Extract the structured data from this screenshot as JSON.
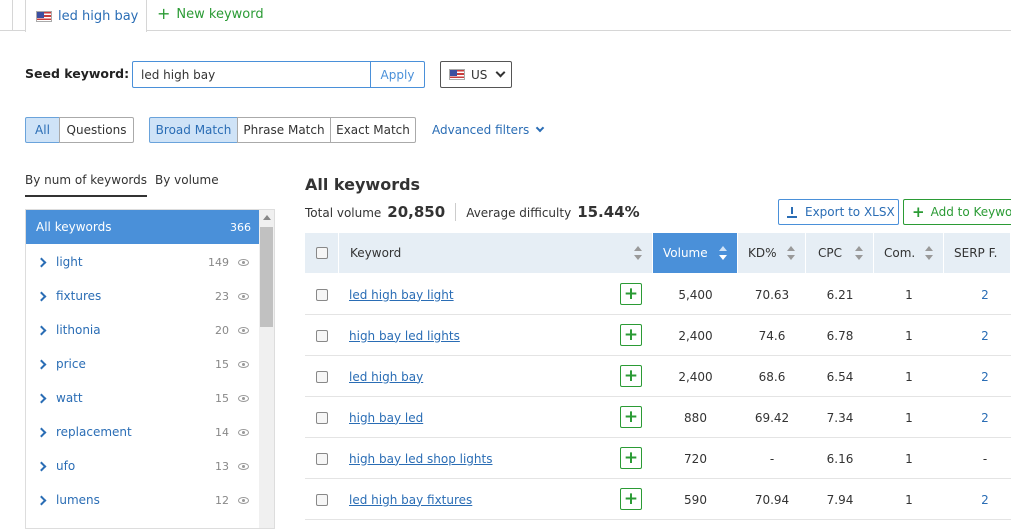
{
  "tabs": {
    "active_label": "led high bay",
    "new_label": "New keyword"
  },
  "seed": {
    "label": "Seed keyword:",
    "value": "led high bay",
    "apply_label": "Apply",
    "database": "US"
  },
  "filters": {
    "all_label": "All",
    "questions_label": "Questions",
    "broad_label": "Broad Match",
    "phrase_label": "Phrase Match",
    "exact_label": "Exact Match",
    "advanced_label": "Advanced filters"
  },
  "sidebar": {
    "tab_by_num": "By num of keywords",
    "tab_by_volume": "By volume",
    "header": {
      "label": "All keywords",
      "count": "366"
    },
    "groups": [
      {
        "label": "light",
        "count": "149"
      },
      {
        "label": "fixtures",
        "count": "23"
      },
      {
        "label": "lithonia",
        "count": "20"
      },
      {
        "label": "price",
        "count": "15"
      },
      {
        "label": "watt",
        "count": "15"
      },
      {
        "label": "replacement",
        "count": "14"
      },
      {
        "label": "ufo",
        "count": "13"
      },
      {
        "label": "lumens",
        "count": "12"
      }
    ]
  },
  "main": {
    "title": "All keywords",
    "total_volume_label": "Total volume",
    "total_volume": "20,850",
    "avg_difficulty_label": "Average difficulty",
    "avg_difficulty": "15.44%",
    "export_label": "Export to XLSX",
    "add_label": "Add to Keyword"
  },
  "table": {
    "headers": {
      "keyword": "Keyword",
      "volume": "Volume",
      "kd": "KD%",
      "cpc": "CPC",
      "com": "Com.",
      "serp": "SERP F."
    },
    "rows": [
      {
        "keyword": "led high bay light",
        "volume": "5,400",
        "kd": "70.63",
        "cpc": "6.21",
        "com": "1",
        "serp": "2"
      },
      {
        "keyword": "high bay led lights",
        "volume": "2,400",
        "kd": "74.6",
        "cpc": "6.78",
        "com": "1",
        "serp": "2"
      },
      {
        "keyword": "led high bay",
        "volume": "2,400",
        "kd": "68.6",
        "cpc": "6.54",
        "com": "1",
        "serp": "2"
      },
      {
        "keyword": "high bay led",
        "volume": "880",
        "kd": "69.42",
        "cpc": "7.34",
        "com": "1",
        "serp": "2"
      },
      {
        "keyword": "high bay led shop lights",
        "volume": "720",
        "kd": "-",
        "cpc": "6.16",
        "com": "1",
        "serp": "-"
      },
      {
        "keyword": "led high bay fixtures",
        "volume": "590",
        "kd": "70.94",
        "cpc": "7.94",
        "com": "1",
        "serp": "2"
      }
    ]
  },
  "colors": {
    "accent": "#4a90d9",
    "link": "#2a6db5",
    "green": "#2b9b35"
  }
}
